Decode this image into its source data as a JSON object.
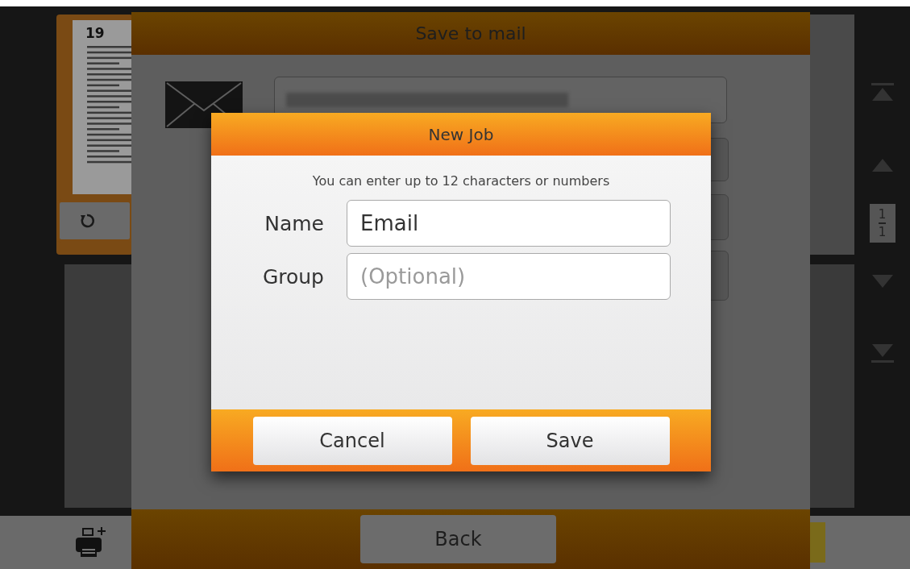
{
  "thumbnail": {
    "page_number": "19"
  },
  "page_indicator": {
    "current": "1",
    "total": "1"
  },
  "mail_dialog": {
    "title": "Save to mail",
    "back_button": "Back"
  },
  "new_job_dialog": {
    "title": "New Job",
    "hint": "You can enter up to 12 characters or numbers",
    "fields": [
      {
        "label": "Name",
        "value": "Email"
      },
      {
        "label": "Group",
        "placeholder": "(Optional)"
      }
    ],
    "buttons": [
      "Cancel",
      "Save"
    ]
  }
}
